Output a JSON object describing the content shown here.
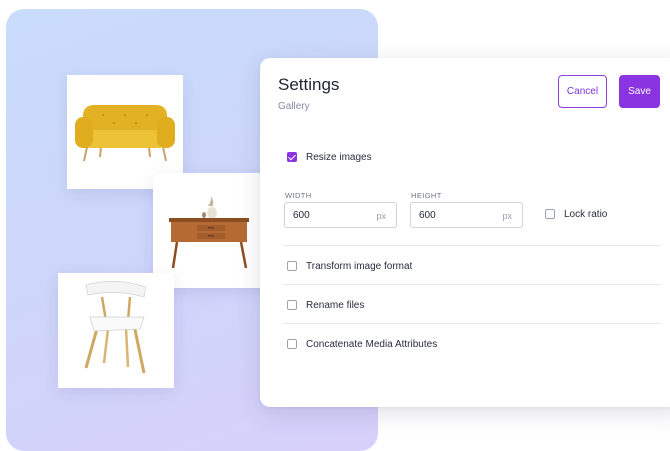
{
  "settings": {
    "title": "Settings",
    "subtitle": "Gallery",
    "cancel_label": "Cancel",
    "save_label": "Save",
    "resize": {
      "label": "Resize images",
      "checked": true
    },
    "width": {
      "label": "WIDTH",
      "value": "600",
      "unit": "px"
    },
    "height": {
      "label": "HEIGHT",
      "value": "600",
      "unit": "px"
    },
    "lock_ratio": {
      "label": "Lock ratio",
      "checked": false
    },
    "options": [
      {
        "label": "Transform image format",
        "checked": false
      },
      {
        "label": "Rename files",
        "checked": false
      },
      {
        "label": "Concatenate Media Attributes",
        "checked": false
      }
    ]
  },
  "gallery": {
    "photos": [
      "yellow-sofa",
      "wooden-sideboard",
      "white-chair"
    ]
  },
  "colors": {
    "accent": "#8a33e0",
    "panel_gradient_top": "#c9dcfb",
    "panel_gradient_bottom": "#d7d0fb",
    "sofa": "#e8b92a"
  }
}
